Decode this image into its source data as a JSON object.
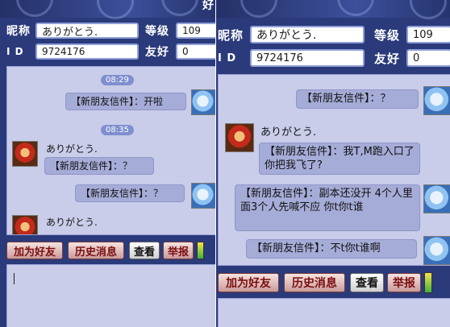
{
  "left": {
    "corner_glyph": "好",
    "nickname_label": "昵称",
    "nickname_value": "ありがとう.",
    "level_label": "等级",
    "level_value": "109",
    "id_label": "I D",
    "id_value": "9724176",
    "friendship_label": "友好",
    "friendship_value": "0",
    "messages": [
      {
        "time": "08:29",
        "text": "【新朋友信件】：开啦"
      },
      {
        "time": "08:35",
        "sender": "ありがとう.",
        "text": "【新朋友信件】：？"
      },
      {
        "text": "【新朋友信件】：？"
      },
      {
        "sender": "ありがとう."
      }
    ],
    "buttons": {
      "add_friend": "加为好友",
      "history": "历史消息",
      "view": "查看",
      "report": "举报"
    }
  },
  "right": {
    "nickname_label": "昵称",
    "nickname_value": "ありがとう.",
    "level_label": "等级",
    "level_value": "109",
    "id_label": "I D",
    "id_value": "9724176",
    "friendship_label": "友好",
    "friendship_value": "0",
    "messages": [
      {
        "text": "【新朋友信件】：？"
      },
      {
        "sender": "ありがとう.",
        "text": "【新朋友信件】：我T,M跑入口了 你把我飞了?"
      },
      {
        "text": "【新朋友信件】：副本还没开 4个人里面3个人先喊不应  你t你t谁"
      },
      {
        "text": "【新朋友信件】：不t你t谁啊"
      }
    ],
    "buttons": {
      "add_friend": "加为好友",
      "history": "历史消息",
      "view": "查看",
      "report": "举报"
    }
  }
}
